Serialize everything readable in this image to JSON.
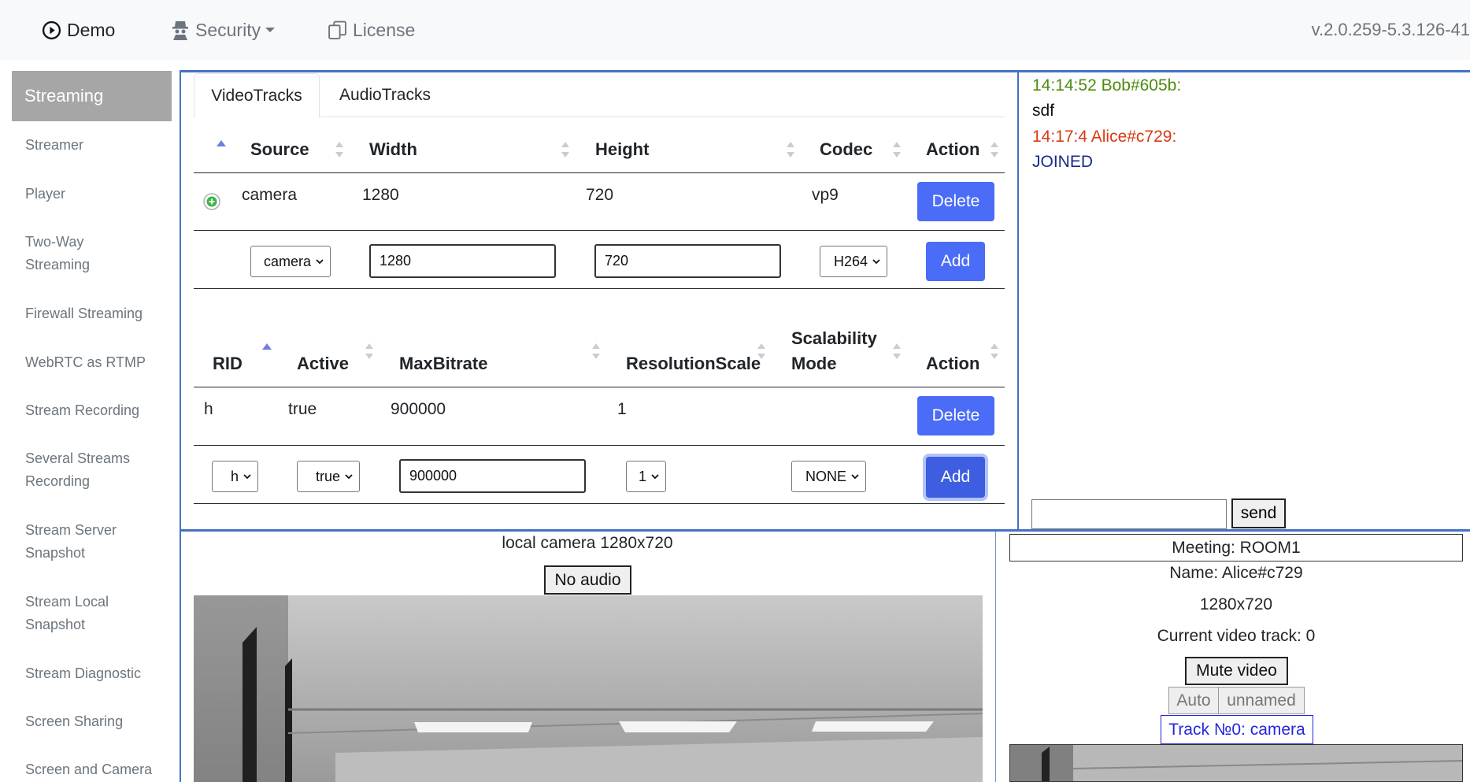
{
  "nav": {
    "demo": "Demo",
    "security": "Security",
    "license": "License",
    "version": "v.2.0.259-5.3.126-41"
  },
  "sidebar": {
    "active": "Streaming",
    "items": [
      "Streamer",
      "Player",
      "Two-Way Streaming",
      "Firewall Streaming",
      "WebRTC as RTMP",
      "Stream Recording",
      "Several Streams Recording",
      "Stream Server Snapshot",
      "Stream Local Snapshot",
      "Stream Diagnostic",
      "Screen Sharing",
      "Screen and Camera"
    ]
  },
  "tabs": [
    "VideoTracks",
    "AudioTracks"
  ],
  "video_table": {
    "headers": [
      "Source",
      "Width",
      "Height",
      "Codec",
      "Action"
    ],
    "row": {
      "source": "camera",
      "width": "1280",
      "height": "720",
      "codec": "vp9",
      "action": "Delete"
    },
    "form": {
      "source": "camera",
      "width": "1280",
      "height": "720",
      "codec": "H264",
      "action": "Add"
    }
  },
  "encoding_table": {
    "headers": [
      "RID",
      "Active",
      "MaxBitrate",
      "ResolutionScale",
      "Scalability Mode",
      "Action"
    ],
    "row": {
      "rid": "h",
      "active": "true",
      "max_bitrate": "900000",
      "resolution_scale": "1",
      "scalability_mode": "",
      "action": "Delete"
    },
    "form": {
      "rid": "h",
      "active": "true",
      "max_bitrate": "900000",
      "resolution_scale": "1",
      "scalability_mode": "NONE",
      "action": "Add"
    }
  },
  "chat": {
    "messages": [
      {
        "header": "14:14:52 Bob#605b:",
        "body": "sdf",
        "color": "#4f8a10"
      },
      {
        "header": "14:17:4 Alice#c729:",
        "body": "JOINED",
        "color": "#d83a12",
        "body_color": "#1a2a8a"
      }
    ],
    "input_value": "",
    "send": "send"
  },
  "local": {
    "title": "local camera 1280x720",
    "audio_button": "No audio"
  },
  "room": {
    "meeting": "Meeting: ROOM1",
    "name": "Name: Alice#c729",
    "resolution": "1280x720",
    "current_track": "Current video track: 0",
    "mute_video": "Mute video",
    "auto": "Auto",
    "unnamed": "unnamed",
    "track": "Track №0: camera"
  }
}
